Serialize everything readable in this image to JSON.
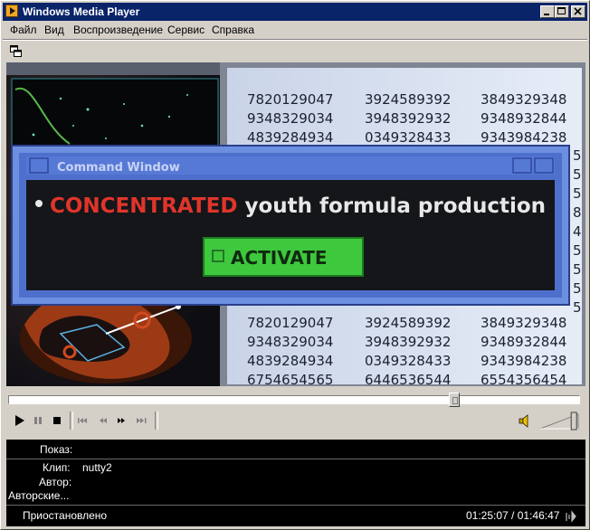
{
  "window": {
    "title": "Windows Media Player"
  },
  "menu": {
    "items": [
      "Файл",
      "Вид",
      "Воспроизведение",
      "Сервис",
      "Справка"
    ]
  },
  "video": {
    "number_rows_top": [
      [
        "7820129047",
        "3924589392",
        "3849329348"
      ],
      [
        "9348329034",
        "3948392932",
        "9348932844"
      ],
      [
        "4839284934",
        "0349328433",
        "9343984238"
      ]
    ],
    "number_rows_bottom": [
      [
        "7820129047",
        "3924589392",
        "3849329348"
      ],
      [
        "9348329034",
        "3948392932",
        "9348932844"
      ],
      [
        "4839284934",
        "0349328433",
        "9343984238"
      ],
      [
        "6754654565",
        "6446536544",
        "6554356454"
      ]
    ],
    "right_digits": [
      "5",
      "5",
      "5",
      "8",
      "4",
      "5",
      "5",
      "5",
      "5"
    ],
    "dialog": {
      "title": "Command Window",
      "highlight_word": "CONCENTRATED",
      "rest_text": " youth formula production",
      "button_label": "ACTIVATE"
    }
  },
  "seek": {
    "progress": 0.786
  },
  "volume": {
    "level": 0.9
  },
  "info": {
    "show_label": "Показ:",
    "show_value": "",
    "clip_label": "Клип:",
    "clip_value": "nutty2",
    "author_label": "Автор:",
    "author_value": "",
    "copyright_label": "Авторские...",
    "copyright_value": "",
    "status": "Приостановлено",
    "time": "01:25:07 / 01:46:47"
  },
  "colors": {
    "titlebar": "#0a246a",
    "dialog_frame": "#4a6fcf",
    "highlight": "#e0352b",
    "activate_button": "#3ec83e"
  }
}
